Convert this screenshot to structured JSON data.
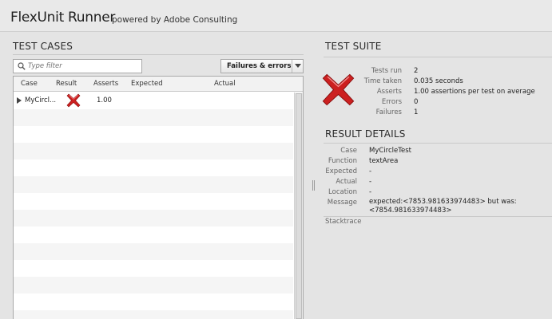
{
  "header": {
    "title": "FlexUnit Runner",
    "subtitle": "powered by Adobe Consulting"
  },
  "test_cases": {
    "title": "TEST CASES",
    "filter_placeholder": "Type filter",
    "filter_select": "Failures & errors",
    "columns": [
      "Case",
      "Result",
      "Asserts",
      "Expected",
      "Actual"
    ],
    "rows": [
      {
        "case": "MyCircl...",
        "result_icon": "fail-icon",
        "asserts": "1.00",
        "expected": "",
        "actual": ""
      }
    ]
  },
  "test_suite": {
    "title": "TEST SUITE",
    "status_icon": "fail-icon",
    "fields": [
      {
        "label": "Tests run",
        "value": "2"
      },
      {
        "label": "Time taken",
        "value": "0.035 seconds"
      },
      {
        "label": "Asserts",
        "value": "1.00 assertions per test on average"
      },
      {
        "label": "Errors",
        "value": "0"
      },
      {
        "label": "Failures",
        "value": "1"
      }
    ]
  },
  "result_details": {
    "title": "RESULT DETAILS",
    "fields": [
      {
        "label": "Case",
        "value": "MyCircleTest"
      },
      {
        "label": "Function",
        "value": "textArea"
      },
      {
        "label": "Expected",
        "value": "-"
      },
      {
        "label": "Actual",
        "value": "-"
      },
      {
        "label": "Location",
        "value": "-"
      },
      {
        "label": "Message",
        "value": "expected:<7853.981633974483> but was:<7854.981633974483>"
      }
    ],
    "stacktrace_label": "Stacktrace"
  },
  "colors": {
    "fail_red": "#cc2020",
    "background": "#e4e4e4"
  }
}
